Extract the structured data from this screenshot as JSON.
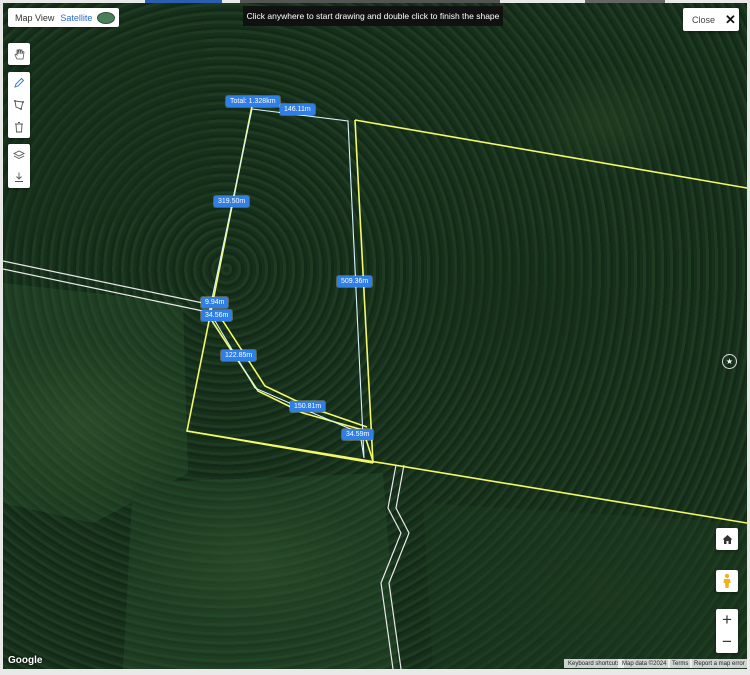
{
  "map_type": {
    "map_view_label": "Map View",
    "satellite_label": "Satellite",
    "selected": "Satellite"
  },
  "hint": "Click anywhere to start drawing and double click to finish the shape",
  "close_button": {
    "label": "Close"
  },
  "tools": {
    "group1": [
      "hand-icon"
    ],
    "group2": [
      "pencil-icon",
      "polygon-icon",
      "trash-icon"
    ],
    "group3": [
      "layers-icon",
      "download-icon"
    ]
  },
  "measurements": {
    "total": "Total: 1.328km",
    "segments": [
      "146.11m",
      "319.50m",
      "509.36m",
      "9.94m",
      "34.56m",
      "122.85m",
      "150.81m",
      "34.59m"
    ]
  },
  "controls": {
    "zoom_in": "+",
    "zoom_out": "−"
  },
  "colors": {
    "boundary": "#f3f96a",
    "drawn_shape": "#ffffff",
    "label_bg": "#2f7fe6"
  },
  "attribution": {
    "logo": "Google",
    "keyboard_shortcuts": "Keyboard shortcuts",
    "map_data": "Map data ©2024",
    "terms": "Terms",
    "report": "Report a map error"
  }
}
